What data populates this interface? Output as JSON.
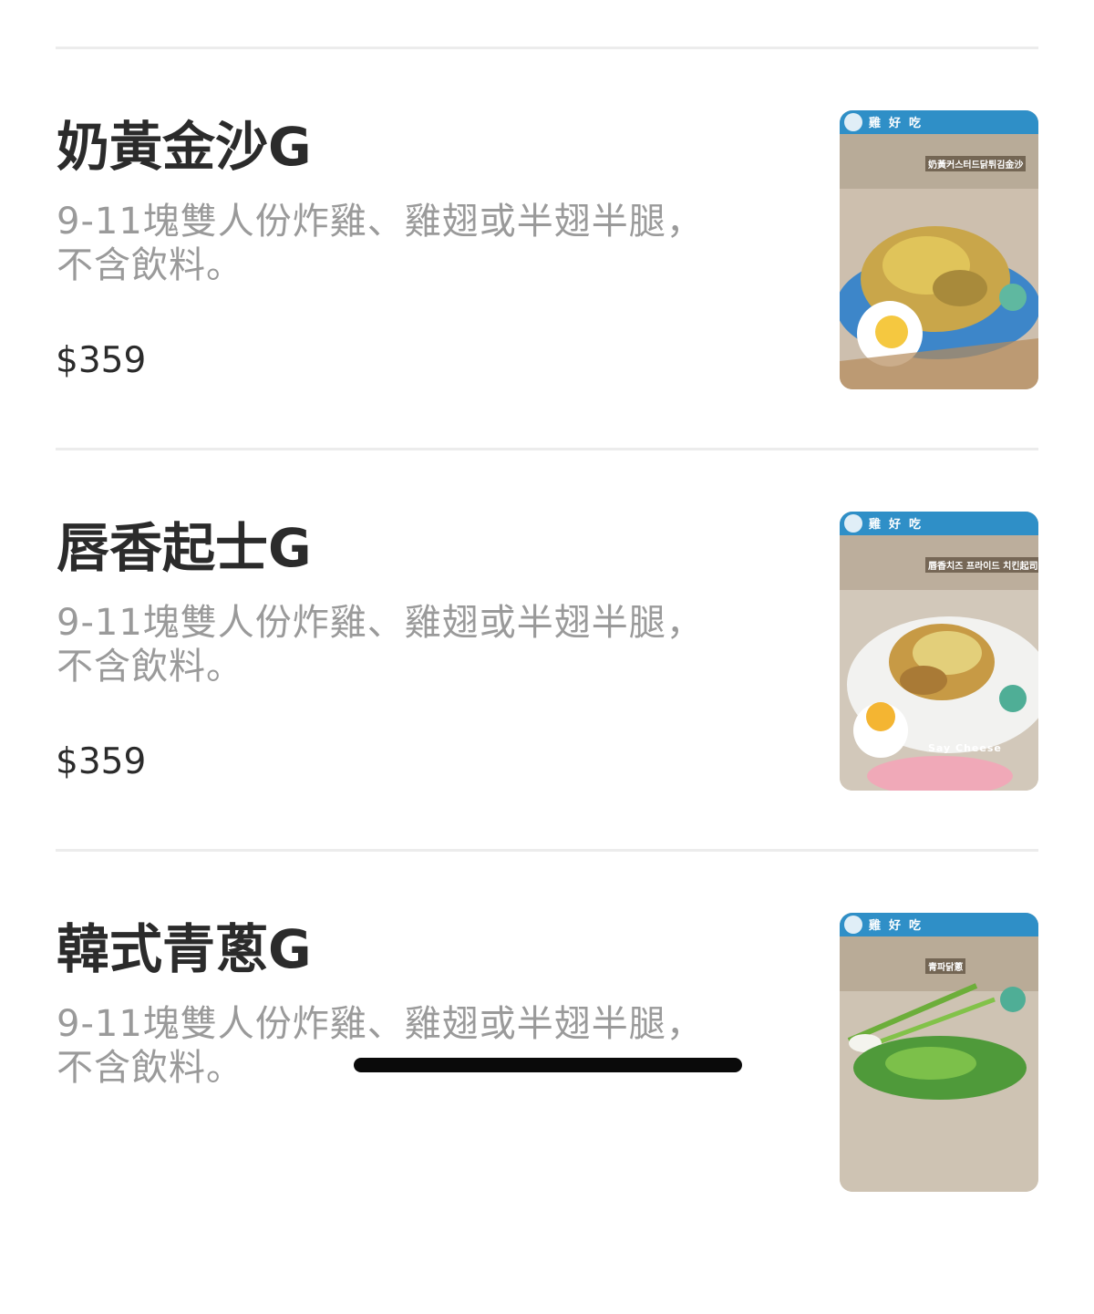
{
  "menu": {
    "items": [
      {
        "title": "奶黃金沙G",
        "description": "9-11塊雙人份炸雞、雞翅或半翅半腿，不含飲料。",
        "price": "$359",
        "photo": {
          "brand": "雞好吃",
          "caption": "奶黃커스터드닭튀김金沙",
          "note": ""
        }
      },
      {
        "title": "唇香起士G",
        "description": "9-11塊雙人份炸雞、雞翅或半翅半腿，不含飲料。",
        "price": "$359",
        "photo": {
          "brand": "雞好吃",
          "caption": "唇香치즈 프라이드 치킨起司",
          "note": "Say Cheese"
        }
      },
      {
        "title": "韓式青蔥G",
        "description": "9-11塊雙人份炸雞、雞翅或半翅半腿，不含飲料。",
        "price": "",
        "photo": {
          "brand": "雞好吃",
          "caption": "青파닭蔥",
          "note": ""
        }
      }
    ]
  },
  "colors": {
    "title": "#2b2b2b",
    "description": "#9a9a9a",
    "divider": "#ececec",
    "photo_header": "#2f8fc7"
  }
}
